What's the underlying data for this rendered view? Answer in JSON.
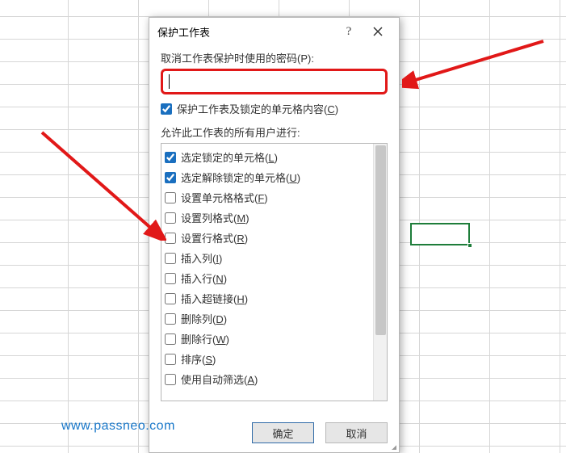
{
  "dialog": {
    "title": "保护工作表",
    "help": "?",
    "password_label": "取消工作表保护时使用的密码(P):",
    "password_value": "",
    "protect_checkbox": {
      "label": "保护工作表及锁定的单元格内容(",
      "key": "C",
      "suffix": ")",
      "checked": true
    },
    "allow_label": "允许此工作表的所有用户进行:",
    "items": [
      {
        "checked": true,
        "label": "选定锁定的单元格(",
        "key": "L",
        "suffix": ")"
      },
      {
        "checked": true,
        "label": "选定解除锁定的单元格(",
        "key": "U",
        "suffix": ")"
      },
      {
        "checked": false,
        "label": "设置单元格格式(",
        "key": "F",
        "suffix": ")"
      },
      {
        "checked": false,
        "label": "设置列格式(",
        "key": "M",
        "suffix": ")"
      },
      {
        "checked": false,
        "label": "设置行格式(",
        "key": "R",
        "suffix": ")"
      },
      {
        "checked": false,
        "label": "插入列(",
        "key": "I",
        "suffix": ")"
      },
      {
        "checked": false,
        "label": "插入行(",
        "key": "N",
        "suffix": ")"
      },
      {
        "checked": false,
        "label": "插入超链接(",
        "key": "H",
        "suffix": ")"
      },
      {
        "checked": false,
        "label": "删除列(",
        "key": "D",
        "suffix": ")"
      },
      {
        "checked": false,
        "label": "删除行(",
        "key": "W",
        "suffix": ")"
      },
      {
        "checked": false,
        "label": "排序(",
        "key": "S",
        "suffix": ")"
      },
      {
        "checked": false,
        "label": "使用自动筛选(",
        "key": "A",
        "suffix": ")"
      }
    ],
    "ok": "确定",
    "cancel": "取消"
  },
  "watermark": "www.passneo.com"
}
